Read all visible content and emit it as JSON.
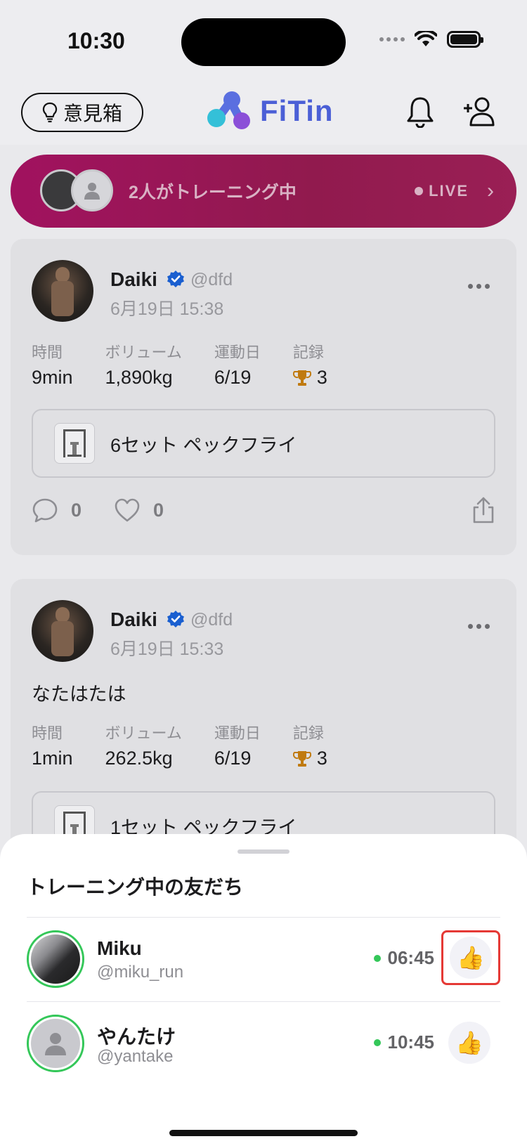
{
  "status_bar": {
    "time": "10:30"
  },
  "header": {
    "feedback_label": "意見箱",
    "logo_text": "FiTin"
  },
  "live_banner": {
    "text": "2人がトレーニング中",
    "live_label": "LIVE"
  },
  "posts": [
    {
      "name": "Daiki",
      "handle": "@dfd",
      "date": "6月19日 15:38",
      "body": "",
      "stats": [
        {
          "label": "時間",
          "value": "9min"
        },
        {
          "label": "ボリューム",
          "value": "1,890kg"
        },
        {
          "label": "運動日",
          "value": "6/19"
        },
        {
          "label": "記録",
          "value": "3"
        }
      ],
      "exercise": "6セット ペックフライ",
      "comments": "0",
      "likes": "0"
    },
    {
      "name": "Daiki",
      "handle": "@dfd",
      "date": "6月19日 15:33",
      "body": "なたはたは",
      "stats": [
        {
          "label": "時間",
          "value": "1min"
        },
        {
          "label": "ボリューム",
          "value": "262.5kg"
        },
        {
          "label": "運動日",
          "value": "6/19"
        },
        {
          "label": "記録",
          "value": "3"
        }
      ],
      "exercise": "1セット ペックフライ"
    }
  ],
  "sheet": {
    "title": "トレーニング中の友だち",
    "friends": [
      {
        "name": "Miku",
        "handle": "@miku_run",
        "time": "06:45",
        "like_emoji": "👍"
      },
      {
        "name": "やんたけ",
        "handle": "@yantake",
        "time": "10:45",
        "like_emoji": "👍"
      }
    ]
  },
  "colors": {
    "accent": "#4b5fd6",
    "live_banner": "#a1125f",
    "online": "#34c759",
    "highlight": "#e53935"
  }
}
